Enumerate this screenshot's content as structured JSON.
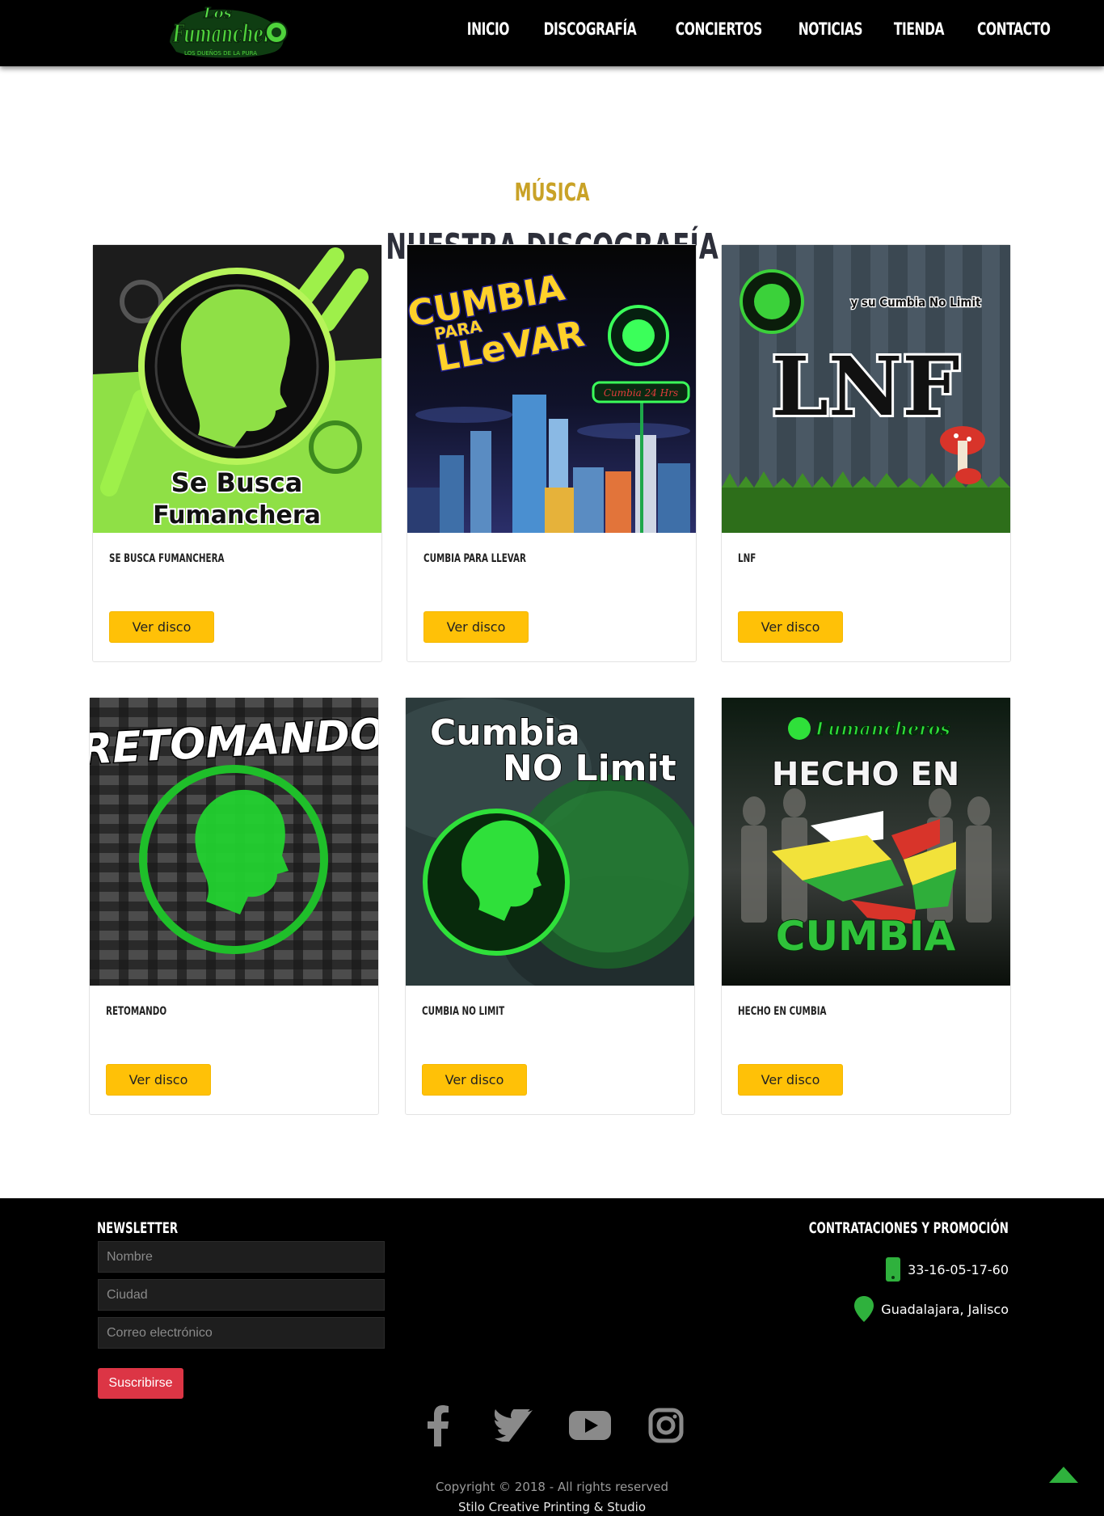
{
  "brand": {
    "logo_text": "Los Fumancheros",
    "logo_tagline": "LOS DUEÑOS DE LA PURA"
  },
  "nav": [
    "INICIO",
    "DISCOGRAFÍA",
    "CONCIERTOS",
    "NOTICIAS",
    "TIENDA",
    "CONTACTO"
  ],
  "section": {
    "eyebrow": "MÚSICA",
    "title": "NUESTRA DISCOGRAFÍA"
  },
  "albums": [
    {
      "title": "SE BUSCA FUMANCHERA",
      "button": "Ver disco",
      "cover_text": [
        "Se Busca",
        "Fumanchera"
      ]
    },
    {
      "title": "CUMBIA PARA LLEVAR",
      "button": "Ver disco",
      "cover_text": [
        "CUMBIA",
        "PARA",
        "LLeVAR",
        "Cumbia 24 Hrs"
      ]
    },
    {
      "title": "LNF",
      "button": "Ver disco",
      "cover_text": [
        "y su Cumbia No Limit",
        "LNF"
      ]
    },
    {
      "title": "RETOMANDO",
      "button": "Ver disco",
      "cover_text": [
        "RETOMANDO"
      ]
    },
    {
      "title": "CUMBIA NO LIMIT",
      "button": "Ver disco",
      "cover_text": [
        "Cumbia",
        "NO Limit"
      ]
    },
    {
      "title": "HECHO EN CUMBIA",
      "button": "Ver disco",
      "cover_text": [
        "HECHO EN",
        "CUMBIA"
      ]
    }
  ],
  "footer": {
    "newsletter": {
      "title": "NEWSLETTER",
      "name_placeholder": "Nombre",
      "city_placeholder": "Ciudad",
      "email_placeholder": "Correo electrónico",
      "submit": "Suscribirse"
    },
    "contact": {
      "title": "CONTRATACIONES Y PROMOCIÓN",
      "phone": "33-16-05-17-60",
      "location": "Guadalajara, Jalisco"
    },
    "social": [
      "facebook-icon",
      "twitter-icon",
      "youtube-icon",
      "instagram-icon"
    ],
    "copyright": "Copyright © 2018 - All rights reserved",
    "credit": "Stilo Creative Printing & Studio"
  },
  "colors": {
    "accent_gold": "#c9a227",
    "button_yellow": "#ffc107",
    "subscribe_red": "#dc3545",
    "brand_green": "#2fb13d"
  }
}
